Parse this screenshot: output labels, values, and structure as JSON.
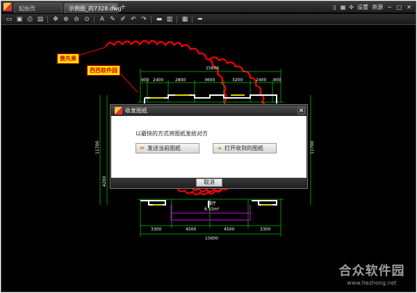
{
  "tabs": [
    {
      "label": "起始页",
      "active": false
    },
    {
      "label": "示例图_的7328.dwg",
      "active": true
    }
  ],
  "top_right": {
    "settings_label": "设置",
    "resources_label": "资源"
  },
  "toolbar": {
    "icons": [
      "open-icon",
      "save-icon",
      "print-icon",
      "image-icon",
      "pan-icon",
      "zoom-in-icon",
      "zoom-out-icon",
      "zoom-extent-icon",
      "text-icon",
      "pen-icon",
      "erase-icon",
      "undo-icon",
      "redo-icon",
      "measure-icon",
      "layer-icon",
      "layout-icon",
      "send-icon"
    ]
  },
  "annotations": {
    "note1": "黄先果",
    "note2": "西西软件园"
  },
  "drawing": {
    "top_total": "15600",
    "top_segments": [
      "900",
      "2400",
      "2800",
      "3600",
      "3200",
      "2400",
      "900"
    ],
    "bottom_segments": [
      "3300",
      "4500",
      "4500",
      "3300"
    ],
    "bottom_total": "15600",
    "left_dim": "11700",
    "right_dim": "11700",
    "left_sub": "4200",
    "room_label": "餐厅",
    "room_area": "6.53m²"
  },
  "dialog": {
    "title": "收发图纸",
    "message": "以最快的方式将图纸发给对方",
    "send_button": "发送当前图纸",
    "open_button": "打开收到的图纸",
    "cancel_button": "取消"
  },
  "watermark": {
    "brand": "合众软件园",
    "url": "www.hezhong.net"
  },
  "colors": {
    "annotation_red": "#ff0000",
    "cad_green": "#00c000",
    "wall_white": "#ffffff",
    "note_yellow": "#ffe600"
  }
}
